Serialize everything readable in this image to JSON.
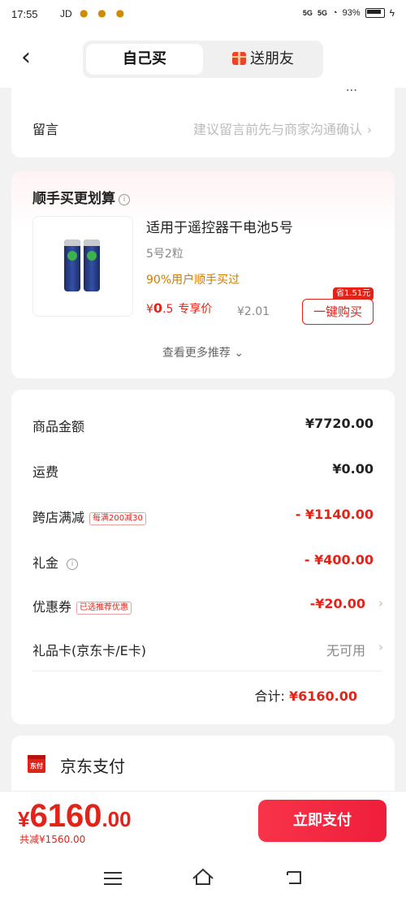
{
  "status_bar": {
    "time": "17:55",
    "carrier": "JD",
    "signal1": "5G",
    "signal2": "5G",
    "battery": "93%"
  },
  "header": {
    "tab_self": "自己买",
    "tab_gift": "送朋友"
  },
  "message": {
    "cut_text": "...",
    "label": "留言",
    "hint": "建议留言前先与商家沟通确认"
  },
  "recommend": {
    "title": "顺手买更划算",
    "product_name": "适用于遥控器干电池5号",
    "spec": "5号2粒",
    "bought": "90%用户顺手买过",
    "price_currency": "¥",
    "price_int": "0",
    "price_dec": ".5",
    "price_label": "专享价",
    "orig_price": "¥2.01",
    "save_tag": "省1.51元",
    "buy_button": "一键购买",
    "more": "查看更多推荐 ⌄"
  },
  "summary": {
    "rows": [
      {
        "label": "商品金额",
        "value": "¥7720.00"
      },
      {
        "label": "运费",
        "value": "¥0.00"
      },
      {
        "label": "跨店满减",
        "tag": "每满200减30",
        "value": "- ¥1140.00"
      },
      {
        "label": "礼金",
        "value": "- ¥400.00"
      },
      {
        "label": "优惠券",
        "tag": "已选推荐优惠",
        "value": "-¥20.00"
      },
      {
        "label": "礼品卡(京东卡/E卡)",
        "value": "无可用"
      }
    ],
    "total_label": "合计:",
    "total_value": "¥6160.00"
  },
  "payment": {
    "method": "京东支付",
    "icon_text": "东付"
  },
  "bottom": {
    "currency": "¥",
    "int": "6160",
    "dec": ".00",
    "saved": "共减¥1560.00",
    "pay_button": "立即支付"
  },
  "colors": {
    "accent": "#e2231a",
    "pay_gradient_start": "#f8334a",
    "orange": "#d07b00"
  }
}
